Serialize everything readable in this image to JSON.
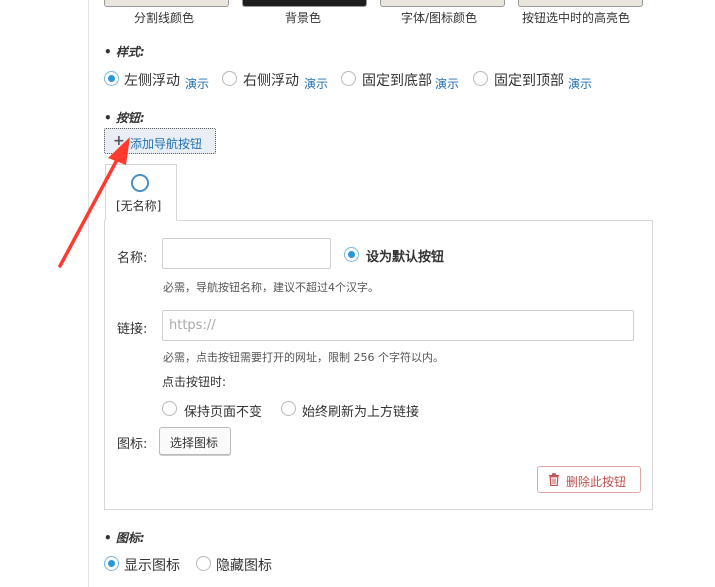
{
  "colors": {
    "accent": "#2a97d6",
    "link": "#2271b1",
    "danger": "#c0504d",
    "arrow": "#ff3b30"
  },
  "swatches": [
    {
      "label": "分割线颜色",
      "color": "#e9e4dc"
    },
    {
      "label": "背景色",
      "color": "#1e1e1e"
    },
    {
      "label": "字体/图标颜色",
      "color": "#e9e4dc"
    },
    {
      "label": "按钮选中时的高亮色",
      "color": "#e9e4dc"
    }
  ],
  "style_section": {
    "label": "• 样式:",
    "options": [
      {
        "label": "左侧浮动",
        "demo": "演示",
        "checked": true
      },
      {
        "label": "右侧浮动",
        "demo": "演示",
        "checked": false
      },
      {
        "label": "固定到底部",
        "demo": "演示",
        "checked": false
      },
      {
        "label": "固定到顶部",
        "demo": "演示",
        "checked": false
      }
    ]
  },
  "buttons_section": {
    "label": "• 按钮:",
    "add_button": "添加导航按钮",
    "tab_label": "[无名称]",
    "name_label": "名称:",
    "name_value": "",
    "default_label": "设为默认按钮",
    "default_checked": true,
    "name_hint": "必需，导航按钮名称，建议不超过4个汉字。",
    "link_label": "链接:",
    "link_placeholder": "https://",
    "link_hint": "必需，点击按钮需要打开的网址，限制 256 个字符以内。",
    "click_label": "点击按钮时:",
    "click_options": [
      {
        "label": "保持页面不变",
        "checked": false
      },
      {
        "label": "始终刷新为上方链接",
        "checked": false
      }
    ],
    "icon_label": "图标:",
    "choose_icon": "选择图标",
    "delete_button": "删除此按钮"
  },
  "icon_section": {
    "label": "• 图标:",
    "options": [
      {
        "label": "显示图标",
        "checked": true
      },
      {
        "label": "隐藏图标",
        "checked": false
      }
    ]
  }
}
